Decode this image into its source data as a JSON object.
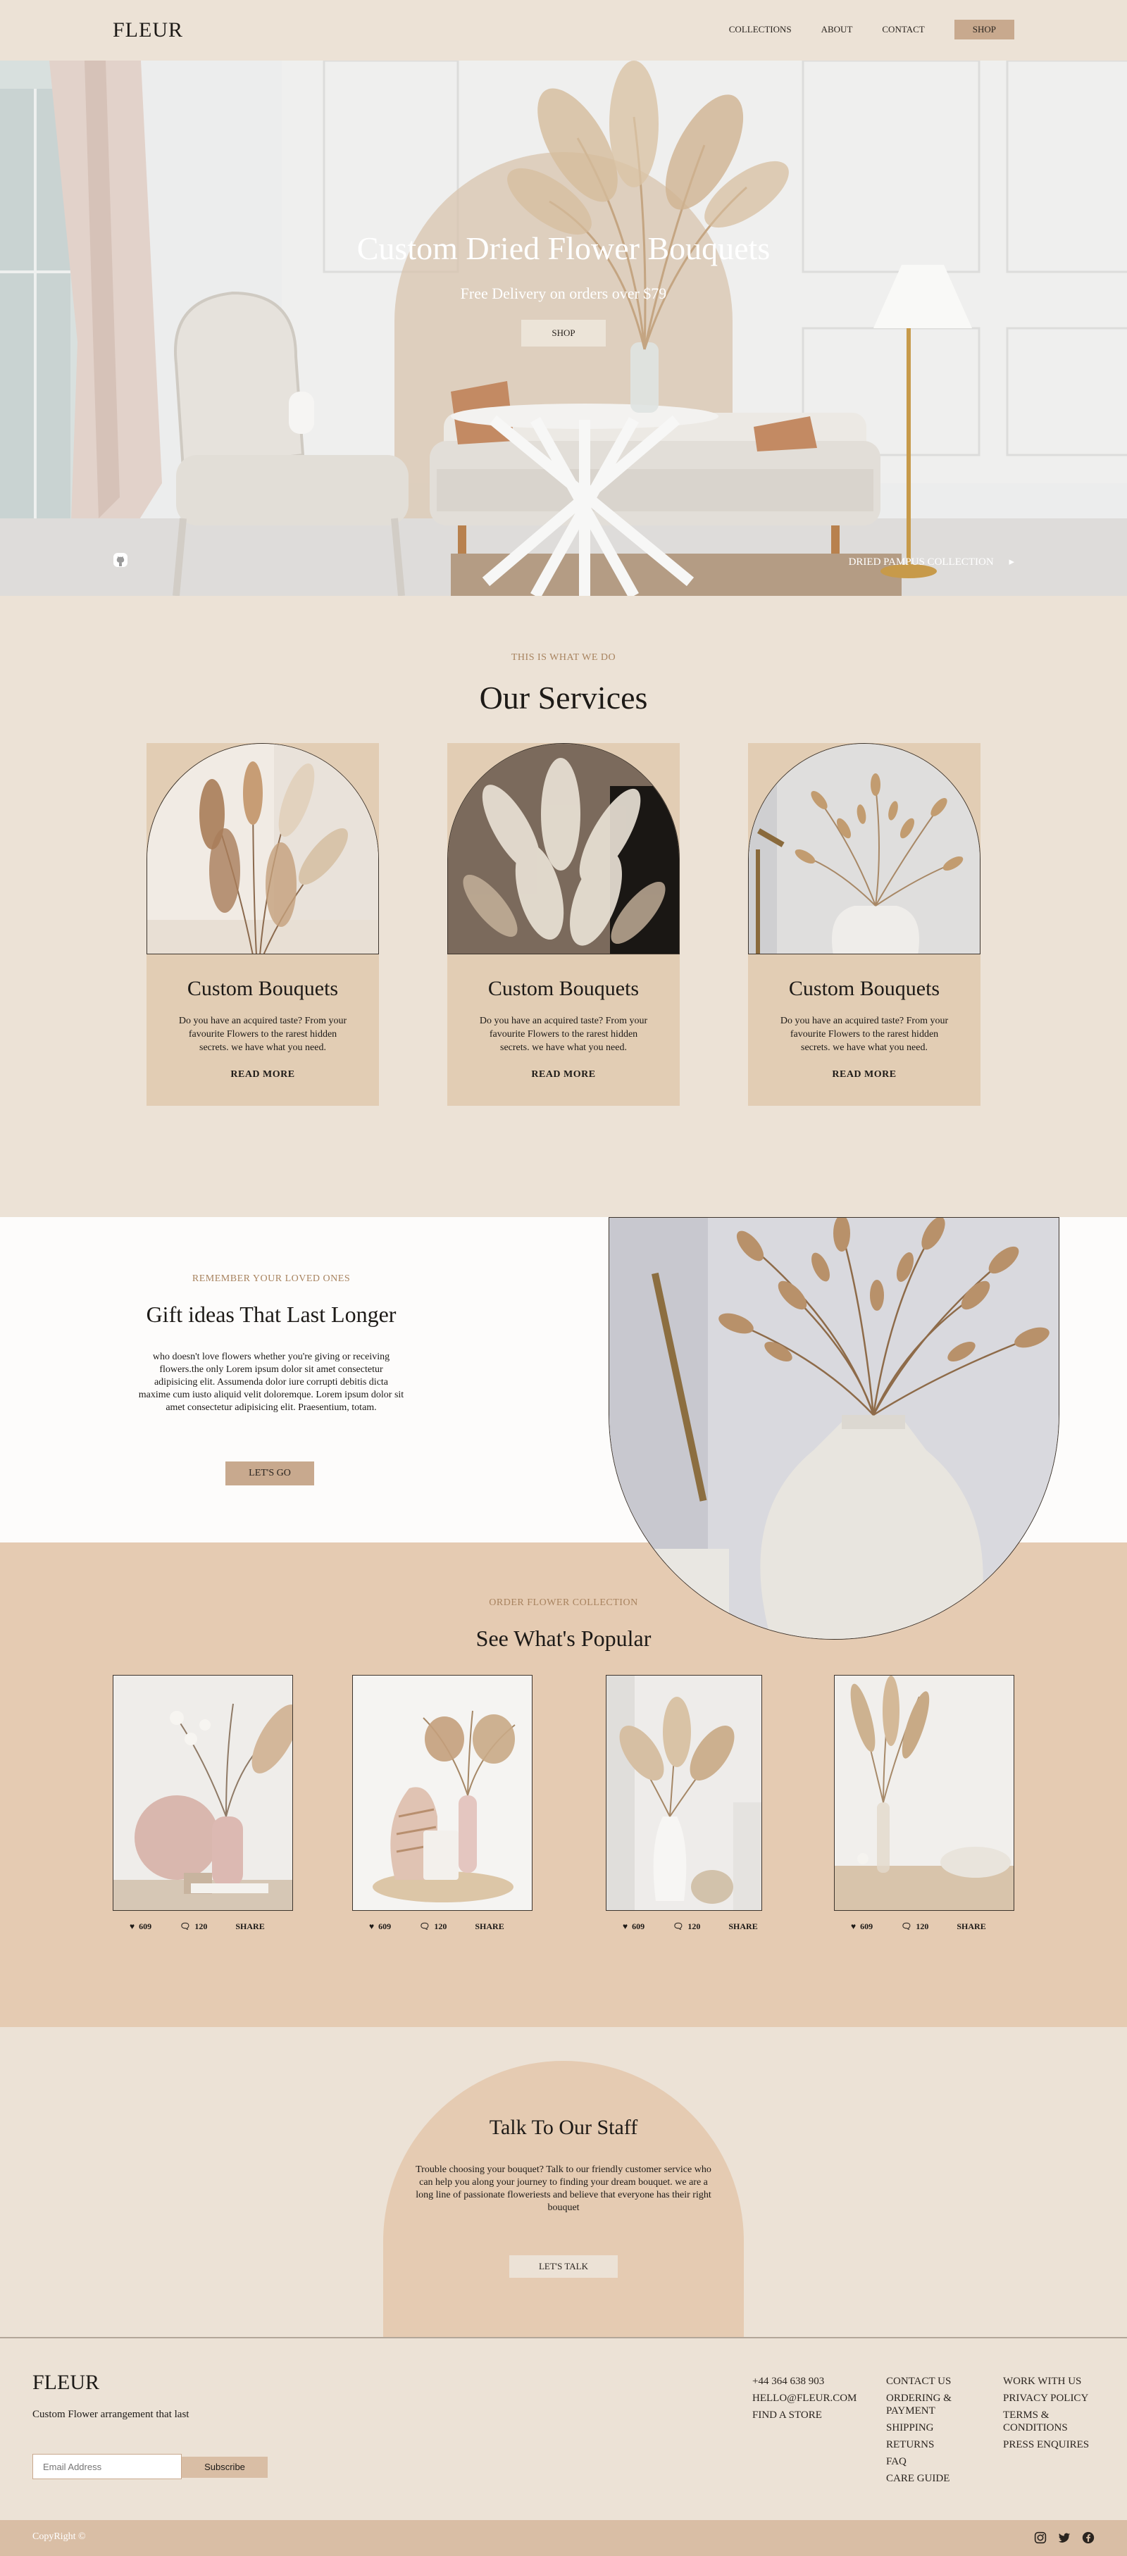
{
  "header": {
    "logo": "FLEUR",
    "nav": [
      "COLLECTIONS",
      "ABOUT",
      "CONTACT"
    ],
    "shop_label": "SHOP"
  },
  "hero": {
    "title": "Custom Dried Flower Bouquets",
    "subtitle": "Free Delivery on orders over $79",
    "button": "SHOP",
    "socials": [
      "instagram-icon",
      "twitter-icon",
      "facebook-icon",
      "github-icon"
    ],
    "collection_link": "DRIED PAMPUS COLLECTION"
  },
  "services": {
    "eyebrow": "THIS IS WHAT WE DO",
    "title": "Our Services",
    "cards": [
      {
        "title": "Custom Bouquets",
        "text": "Do you have an acquired taste? From your favourite Flowers to the rarest hidden secrets. we have what you need.",
        "link": "READ MORE"
      },
      {
        "title": "Custom Bouquets",
        "text": "Do you have an acquired taste? From your favourite Flowers to the rarest hidden secrets. we have what you need.",
        "link": "READ MORE"
      },
      {
        "title": "Custom Bouquets",
        "text": "Do you have an acquired taste? From your favourite Flowers to the rarest hidden secrets. we have what you need.",
        "link": "READ MORE"
      }
    ]
  },
  "gift": {
    "eyebrow": "REMEMBER YOUR LOVED ONES",
    "title": "Gift ideas That Last Longer",
    "text": "who doesn't love flowers whether you're giving or receiving flowers.the only Lorem ipsum dolor sit amet consectetur adipisicing elit. Assumenda dolor iure corrupti debitis dicta maxime cum iusto aliquid velit doloremque. Lorem ipsum dolor sit amet consectetur adipisicing elit. Praesentium, totam.",
    "button": "LET'S GO"
  },
  "popular": {
    "eyebrow": "ORDER FLOWER COLLECTION",
    "title": "See What's Popular",
    "items": [
      {
        "likes": "609",
        "comments": "120",
        "share": "SHARE"
      },
      {
        "likes": "609",
        "comments": "120",
        "share": "SHARE"
      },
      {
        "likes": "609",
        "comments": "120",
        "share": "SHARE"
      },
      {
        "likes": "609",
        "comments": "120",
        "share": "SHARE"
      }
    ]
  },
  "talk": {
    "title": "Talk To Our Staff",
    "text": "Trouble choosing your bouquet? Talk to our friendly customer service who can help you along your journey to finding your dream bouquet. we are a long line of passionate floweriests and believe that everyone has their right bouquet",
    "button": "LET'S TALK"
  },
  "footer": {
    "logo": "FLEUR",
    "tagline": "Custom Flower arrangement that last",
    "email_placeholder": "Email Address",
    "subscribe": "Subscribe",
    "contact": [
      "+44 364 638 903",
      "HELLO@FLEUR.COM",
      "FIND A STORE"
    ],
    "customer": [
      "CONTACT US",
      "ORDERING & PAYMENT",
      "SHIPPING",
      "RETURNS",
      "FAQ",
      "CARE GUIDE"
    ],
    "company": [
      "WORK WITH US",
      "PRIVACY POLICY",
      "TERMS & CONDITIONS",
      "PRESS ENQUIRES"
    ],
    "copyright": "CopyRight ©"
  },
  "colors": {
    "background": "#ece2d6",
    "card": "#e2cdb4",
    "accent": "#c8a98e",
    "popular_bg": "#e5cbb2"
  }
}
